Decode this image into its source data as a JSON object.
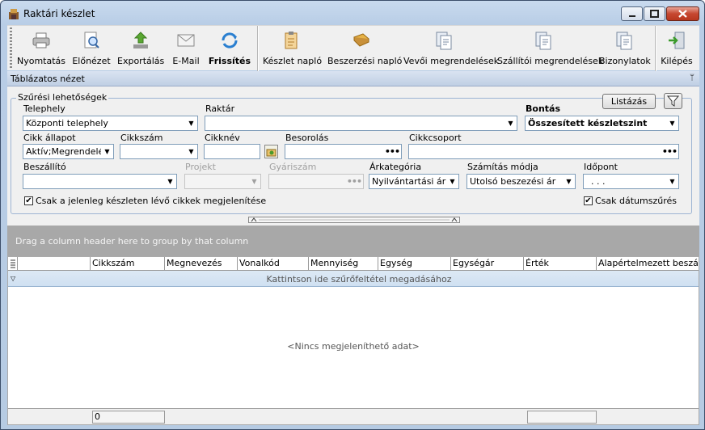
{
  "window": {
    "title": "Raktári készlet"
  },
  "toolbar": {
    "print": "Nyomtatás",
    "preview": "Előnézet",
    "export": "Exportálás",
    "email": "E-Mail",
    "refresh": "Frissítés",
    "stock_log": "Készlet napló",
    "purchase_log": "Beszerzési napló",
    "customer_orders": "Vevői megrendelések",
    "supplier_orders": "Szállítói megrendelések",
    "documents": "Bizonylatok",
    "exit": "Kilépés"
  },
  "panel": {
    "title": "Táblázatos nézet",
    "pin": "ᛘ"
  },
  "filters": {
    "legend": "Szűrési lehetőségek",
    "list_button": "Listázás",
    "site_label": "Telephely",
    "site_value": "Központi telephely",
    "warehouse_label": "Raktár",
    "warehouse_value": "",
    "breakdown_label": "Bontás",
    "breakdown_value": "Összesített készletszint",
    "item_status_label": "Cikk állapot",
    "item_status_value": "Aktív;Megrendelésr",
    "item_number_label": "Cikkszám",
    "item_number_value": "",
    "item_name_label": "Cikknév",
    "item_name_value": "",
    "classification_label": "Besorolás",
    "classification_value": "",
    "item_group_label": "Cikkcsoport",
    "item_group_value": "",
    "supplier_label": "Beszállító",
    "supplier_value": "",
    "project_label": "Projekt",
    "project_value": "",
    "serial_label": "Gyáriszám",
    "serial_value": "",
    "price_category_label": "Árkategória",
    "price_category_value": "Nyilvántartási ár (L",
    "calc_method_label": "Számítás módja",
    "calc_method_value": "Utolsó beszezési ár",
    "date_label": "Időpont",
    "date_value": ". . .",
    "only_in_stock_label": "Csak a jelenleg készleten lévő cikkek megjelenítése",
    "only_in_stock_checked": "✔",
    "date_filter_label": "Csak dátumszűrés",
    "date_filter_checked": "✔"
  },
  "grid": {
    "group_hint": "Drag a column header here to group by that column",
    "columns": [
      "Cikkszám",
      "Megnevezés",
      "Vonalkód",
      "Mennyiség",
      "Egység",
      "Egységár",
      "Érték",
      "Alapértelmezett beszállító"
    ],
    "filter_row_text": "Kattintson ide szűrőfeltétel megadásához",
    "empty_text": "<Nincs megjeleníthető adat>",
    "footer_count": "0"
  }
}
